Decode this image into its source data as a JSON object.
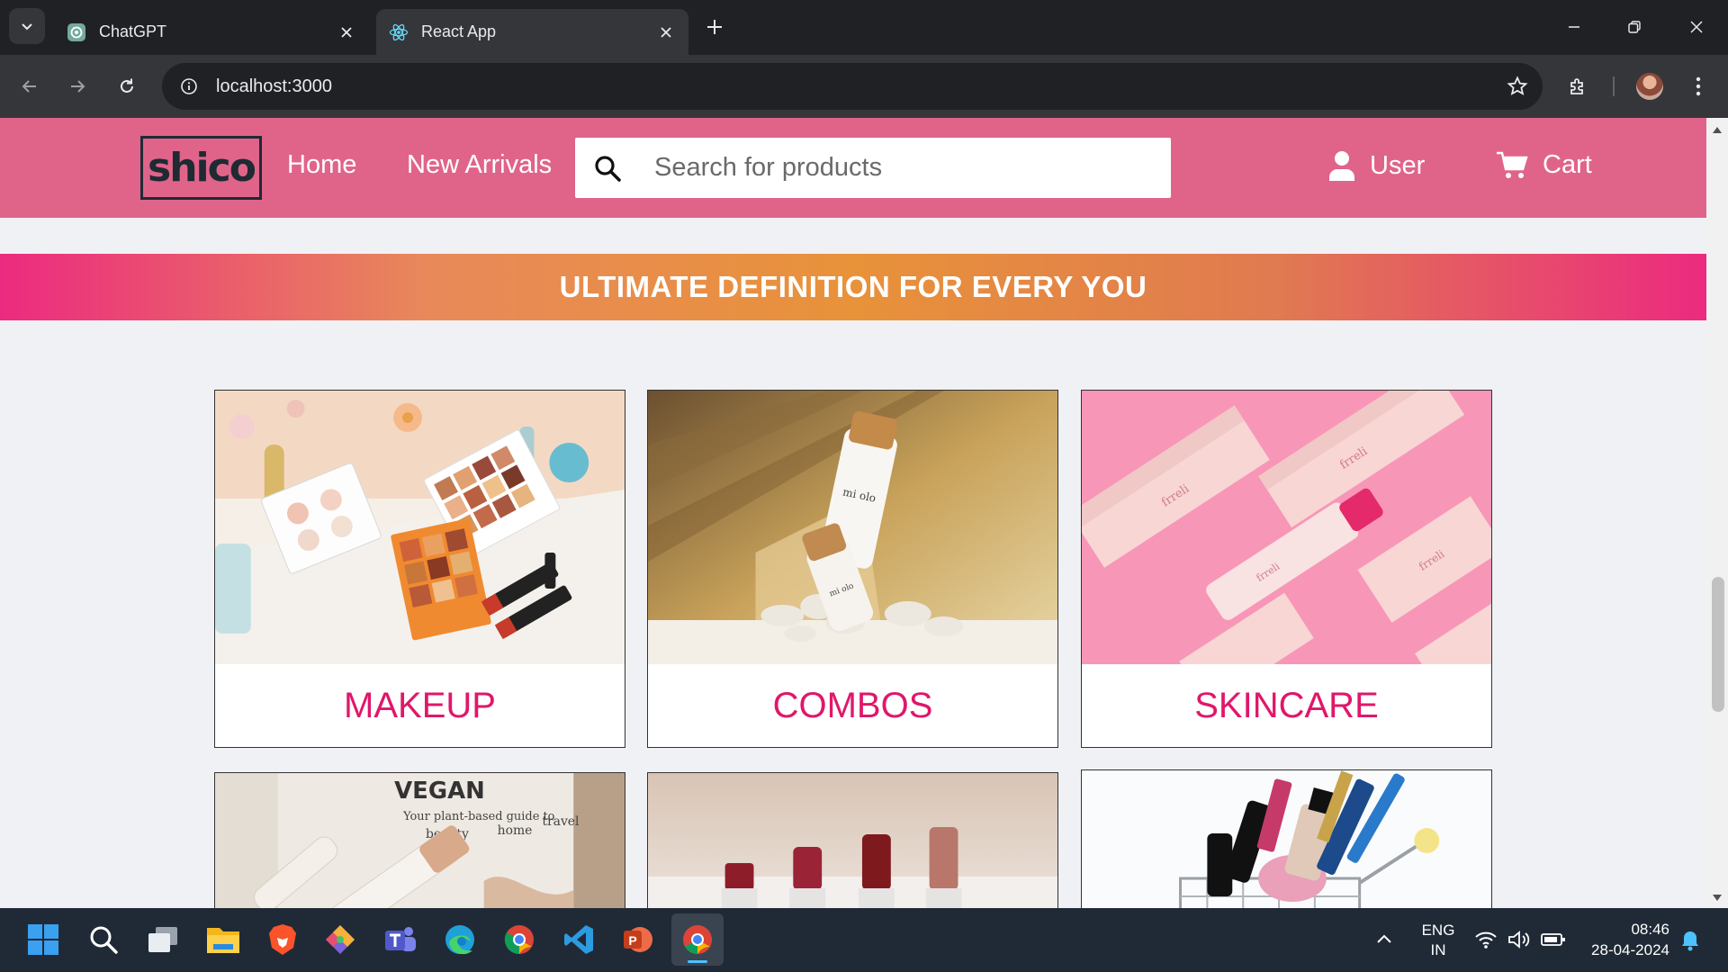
{
  "browser": {
    "tabs": [
      {
        "title": "ChatGPT",
        "active": false,
        "icon": "chatgpt-icon"
      },
      {
        "title": "React App",
        "active": true,
        "icon": "react-icon"
      }
    ],
    "url": "localhost:3000"
  },
  "header": {
    "logo": "shico",
    "nav": [
      {
        "label": "Home"
      },
      {
        "label": "New Arrivals"
      }
    ],
    "search_placeholder": "Search for products",
    "user_label": "User",
    "cart_label": "Cart",
    "colors": {
      "header_bg": "#e0648a",
      "label_pink": "#e0176a"
    }
  },
  "banner": {
    "text": "ULTIMATE DEFINITION FOR EVERY YOU"
  },
  "categories": [
    {
      "label": "MAKEUP"
    },
    {
      "label": "COMBOS"
    },
    {
      "label": "SKINCARE"
    },
    {
      "label": ""
    },
    {
      "label": ""
    },
    {
      "label": ""
    }
  ],
  "taskbar": {
    "lang_primary": "ENG",
    "lang_secondary": "IN",
    "time": "08:46",
    "date": "28-04-2024"
  }
}
